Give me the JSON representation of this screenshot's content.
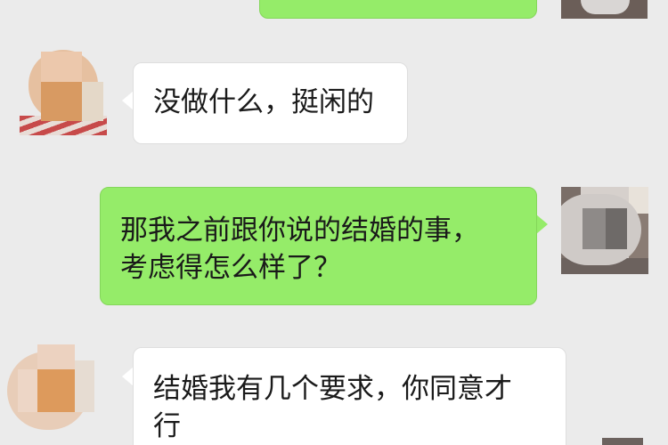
{
  "colors": {
    "background": "#ebebeb",
    "incoming_bubble": "#ffffff",
    "outgoing_bubble": "#95ec69",
    "text": "#1a1a1a"
  },
  "messages": [
    {
      "from": "me",
      "text": ""
    },
    {
      "from": "contact",
      "text": "没做什么，挺闲的"
    },
    {
      "from": "me",
      "line1": "那我之前跟你说的结婚的事，",
      "line2": "考虑得怎么样了？"
    },
    {
      "from": "contact",
      "line1": "结婚我有几个要求，你同意才",
      "line2": "行"
    }
  ],
  "avatars": {
    "contact": "contact-avatar-icon (pixelated)",
    "me": "user-avatar-icon (pixelated)"
  }
}
